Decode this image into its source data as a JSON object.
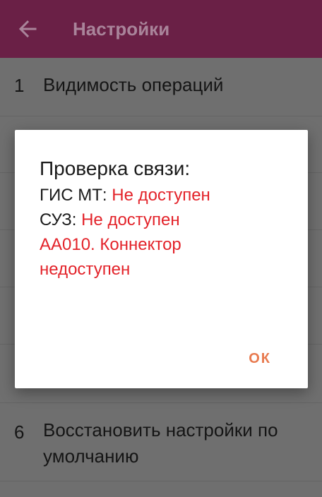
{
  "appbar": {
    "title": "Настройки",
    "back_icon": "arrow-left-icon"
  },
  "settings": [
    {
      "number": "1",
      "label": "Видимость операций"
    },
    {
      "number": "6",
      "label": "Восстановить настройки по умолчанию"
    }
  ],
  "dialog": {
    "title": "Проверка связи:",
    "gis_label": "ГИС МТ: ",
    "gis_status": "Не доступен",
    "suz_label": "СУЗ: ",
    "suz_status": "Не доступен",
    "error_line1": "АА010. Коннектор",
    "error_line2": "недоступен",
    "ok_label": "ОК"
  },
  "colors": {
    "appbar": "#6a2046",
    "error_text": "#e3232a",
    "ok_button": "#e87a4f"
  }
}
